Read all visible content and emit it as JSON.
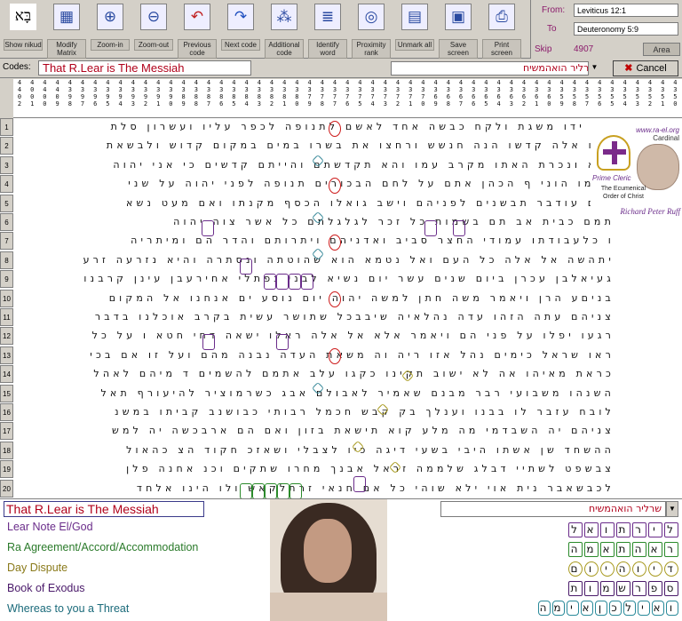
{
  "toolbar": {
    "buttons": [
      {
        "label": "Show nikud",
        "icon": "nikud-icon"
      },
      {
        "label": "Modify Matrix",
        "icon": "matrix-icon"
      },
      {
        "label": "Zoom-in",
        "icon": "zoom-in-icon"
      },
      {
        "label": "Zoom-out",
        "icon": "zoom-out-icon"
      },
      {
        "label": "Previous code",
        "icon": "previous-arrow-icon"
      },
      {
        "label": "Next code",
        "icon": "next-arrow-icon"
      },
      {
        "label": "Additional code",
        "icon": "additional-code-icon"
      },
      {
        "label": "Identify word",
        "icon": "identify-word-icon"
      },
      {
        "label": "Proximity rank",
        "icon": "proximity-icon"
      },
      {
        "label": "Unmark all",
        "icon": "unmark-icon"
      },
      {
        "label": "Save screen",
        "icon": "save-icon"
      },
      {
        "label": "Print screen",
        "icon": "print-icon"
      }
    ]
  },
  "info": {
    "from_label": "From:",
    "from_value": "Leviticus 12:1",
    "to_label": "To",
    "to_value": "Deuteronomy 5:9",
    "skip_label": "Skip",
    "skip_value": "4907",
    "area_label": "Area"
  },
  "codes": {
    "label": "Codes:",
    "title": "That R.Lear is The Messiah",
    "hebrew": "שרליר הואהמשיח",
    "cancel_label": "Cancel"
  },
  "columns": [
    "4\n4\n0\n2",
    "4\n0\n0\n1",
    "4\n4\n0\n0",
    "4\n4\n0\n9",
    "4\n3\n9\n8",
    "4\n3\n9\n7",
    "4\n3\n9\n6",
    "4\n3\n9\n5",
    "4\n3\n9\n4",
    "4\n3\n9\n3",
    "4\n3\n9\n2",
    "4\n3\n9\n1",
    "4\n3\n9\n0",
    "4\n3\n8\n9",
    "4\n3\n8\n8",
    "4\n3\n8\n7",
    "4\n3\n8\n6",
    "4\n3\n8\n5",
    "4\n3\n8\n4",
    "4\n3\n8\n3",
    "4\n3\n8\n2",
    "4\n3\n8\n1",
    "4\n3\n8\n0",
    "4\n3\n7\n9",
    "4\n3\n7\n8",
    "4\n3\n7\n7",
    "4\n3\n7\n6",
    "4\n3\n7\n5",
    "4\n3\n7\n4",
    "4\n3\n7\n3",
    "4\n3\n7\n2",
    "4\n3\n7\n1",
    "4\n3\n7\n0",
    "4\n3\n6\n9",
    "4\n3\n6\n8",
    "4\n3\n6\n7",
    "4\n3\n6\n6",
    "4\n3\n6\n5",
    "4\n3\n6\n4",
    "4\n3\n6\n3",
    "4\n3\n6\n2",
    "4\n3\n6\n1",
    "4\n3\n6\n0",
    "4\n3\n5\n9",
    "4\n3\n5\n8",
    "4\n3\n5\n7",
    "4\n3\n5\n6",
    "4\n3\n5\n5",
    "4\n3\n5\n4",
    "4\n3\n5\n3",
    "4\n3\n5\n2",
    "4\n3\n5\n1",
    "4\n3\n5\n0"
  ],
  "rows": [
    {
      "n": "1",
      "text": "אין ידו משגת ולקח כבשה אחד לאשם לתנופה לכפר עליו ועשרון סלת"
    },
    {
      "n": "2",
      "text": "באו אלה קדשו הנה חנשש ורחצו את בשרו במים במקום קדוש ולבשאת"
    },
    {
      "n": "3",
      "text": "הוא ונכרת האתו מקרב עמו והא תקדשתם והייתם קדשים כי אני יהוה"
    },
    {
      "n": "4",
      "text": "שלמו הוני ף הכהן אתם על לחם הבכורים תנופה לפני יהוה על שני"
    },
    {
      "n": "5",
      "text": "ואם עודבר תבשנים לפניהם וישב גואלו הכסף מקנתו ואם מעט נשא"
    },
    {
      "n": "6",
      "text": "תמם כבית אב תם בשמות כל זכר לגלגלתם כל אשר צוה יהוה"
    },
    {
      "n": "7",
      "text": "ו כלעבודתו עמודי החצר סביב ואדניהם ויתרותם והדר הם ומיתריה"
    },
    {
      "n": "8",
      "text": "יתהשה אל אלה כל העם ואל נטמא הוא שהוטתה ונסתרה והיא נזרעה זרע"
    },
    {
      "n": "9",
      "text": "געיאלבן עכרן ביום שנים עשר יום נשיא לבני נפתלי אחירעבן עינן קרבנו"
    },
    {
      "n": "10",
      "text": "בניםע הרן ויאמר משה חתן למשה יהוה יום נוסע ים אנחנו אל המקום"
    },
    {
      "n": "11",
      "text": "צניהם עתה הזהו עדה נהלאיה שיבבכל שתושר עשית בקרב אוכלנו בדבר"
    },
    {
      "n": "12",
      "text": "רגעו יפלו על פני הם ויאמר אלא אל אלה ראלו ישאה דחי חטא ו על כל"
    },
    {
      "n": "13",
      "text": "ראו שראל כימים נהל אזו ריה וה משאת העדה נבנה מהם ועל זו אם בכי"
    },
    {
      "n": "14",
      "text": "כראת מאיהו אה לא ישוב תקינו כקגו עלב אתמם להשמים ד מיהם לאהל"
    },
    {
      "n": "15",
      "text": "השנהו משבועי רבר מבנם שאמיר לאבולם אבג כשרמוציר להיעורף תאל"
    },
    {
      "n": "16",
      "text": "לובח עזבר לו בבנו וענלך בק קבש חכמל רבותי כבושנב קביתו במשנ"
    },
    {
      "n": "17",
      "text": "צניהם יה השבדמי מה מלע קוא תישאת בזון ואם הם ארבכשה יה למש"
    },
    {
      "n": "18",
      "text": "ההשחד שן אשתו היבי בשעי דיגה כיו לצבלי ושאזכ חקוד הצ כהאול"
    },
    {
      "n": "19",
      "text": "צבשפט לשתיי דבלג שלממה זראל אבנך מחרו שתקים וכנ אחנה פלן"
    },
    {
      "n": "20",
      "text": "לכבשאבר נית אוי ילא שוהי כל אם חנאי זרתלקאש ולו הינו אלחד"
    }
  ],
  "overlay": {
    "site": "www.ra-el.org",
    "cardinal": "Cardinal",
    "prime_cleric": "Prime Cleric",
    "ecumenical": "The Ecumenical Order of Christ",
    "name": "Richard Peter Ruff"
  },
  "bottom": {
    "title": "That R.Lear is The Messiah",
    "hebrew": "שרליר הואהמשיח",
    "notes": [
      {
        "text": "Lear Note El/God",
        "color": "#6a2c8a"
      },
      {
        "text": "Ra Agreement/Accord/Accommodation",
        "color": "#2a7a2a"
      },
      {
        "text": "Day Dispute",
        "color": "#8a7a1a"
      },
      {
        "text": "Book of Exodus",
        "color": "#4a1a6a"
      },
      {
        "text": "Whereas to you a Threat",
        "color": "#1a6a7a"
      }
    ],
    "hebrew_words": [
      {
        "letters": [
          "ל",
          "י",
          "ר",
          "ת",
          "ו",
          "א",
          "ל"
        ],
        "color": "#6a2c8a",
        "shape": "box"
      },
      {
        "letters": [
          "ר",
          "א",
          "ה",
          "ת",
          "א",
          "מ",
          "ה"
        ],
        "color": "#2a8a2a",
        "shape": "box"
      },
      {
        "letters": [
          "ד",
          "י",
          "ו",
          "ה",
          "י",
          "ו",
          "ם"
        ],
        "color": "#a89a20",
        "shape": "circle"
      },
      {
        "letters": [
          "ס",
          "פ",
          "ר",
          "ש",
          "מ",
          "ו",
          "ת"
        ],
        "color": "#4a1a6a",
        "shape": "box"
      },
      {
        "letters": [
          "ו",
          "א",
          "י",
          "ל",
          "כ",
          "ן",
          "א",
          "י",
          "מ",
          "ה"
        ],
        "color": "#2a8a9a",
        "shape": "diamond"
      }
    ]
  },
  "colors": {
    "accent_red": "#b0001a",
    "purple": "#6a2c8a",
    "panel_gray": "#d4d0c8"
  }
}
